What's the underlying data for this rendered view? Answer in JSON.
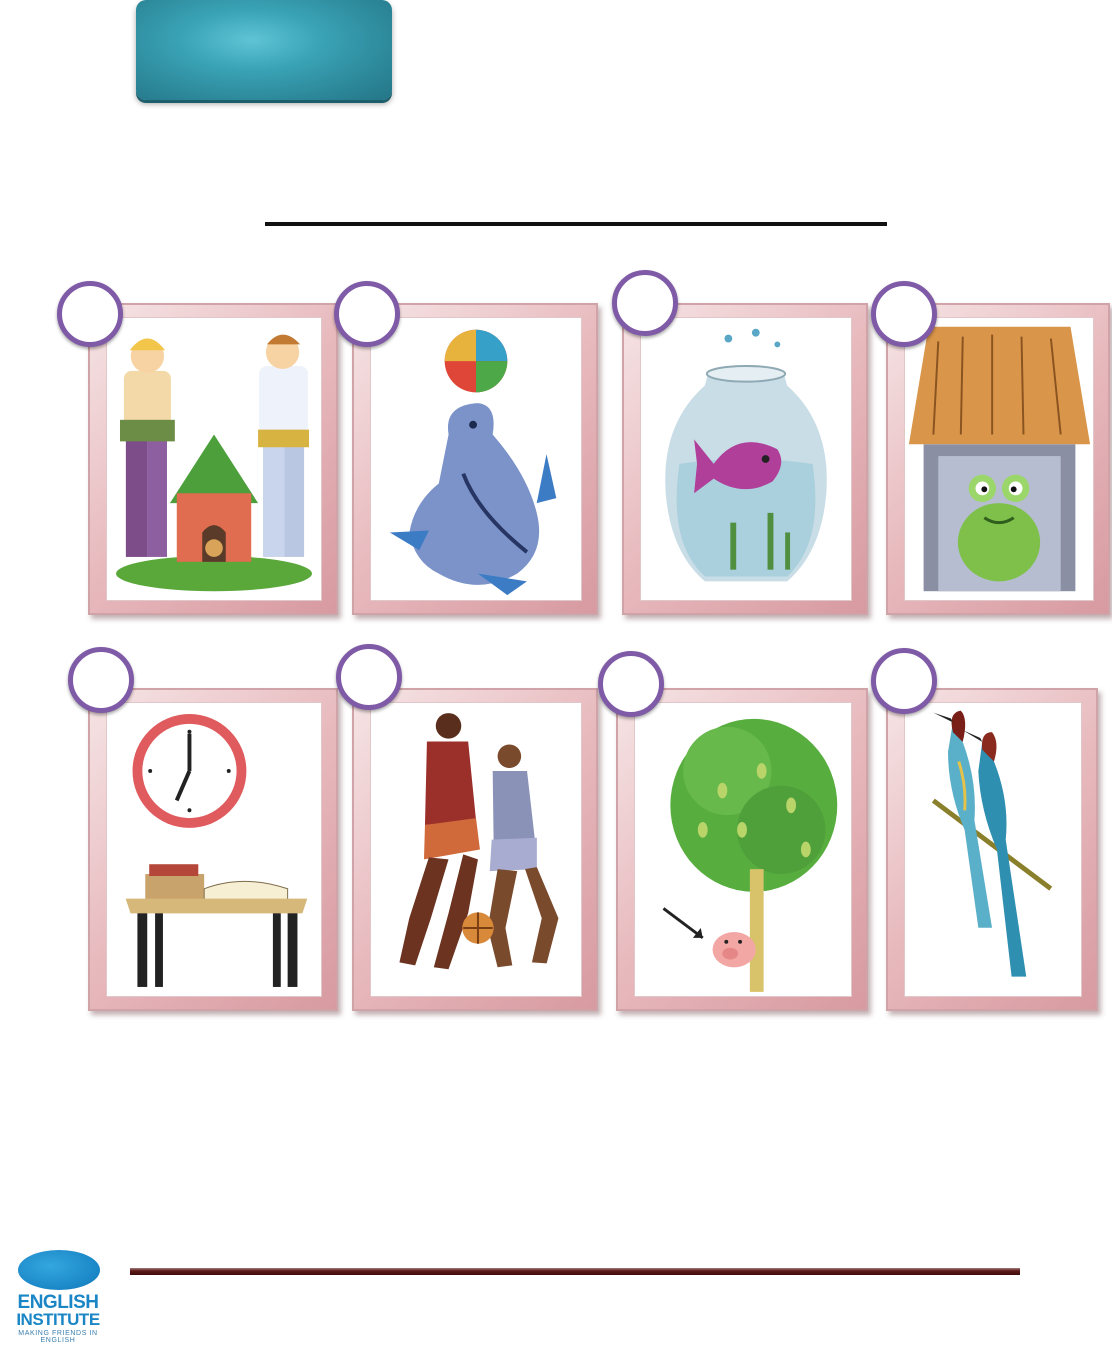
{
  "header": {
    "badge_label": ""
  },
  "title": {
    "text": ""
  },
  "cards": [
    {
      "icon": "doghouse-children-icon"
    },
    {
      "icon": "seal-ball-icon"
    },
    {
      "icon": "fishbowl-icon"
    },
    {
      "icon": "frog-house-icon"
    },
    {
      "icon": "clock-desk-icon"
    },
    {
      "icon": "basketball-players-icon"
    },
    {
      "icon": "pig-tree-icon"
    },
    {
      "icon": "birds-branch-icon"
    }
  ],
  "colors": {
    "badge": "#2b8697",
    "card_frame": "#d79aa0",
    "circle_border": "#7f5aa6",
    "footer_rule": "#5e1a1a",
    "logo_blue": "#1a86c6"
  },
  "footer": {
    "logo_line1": "ENGLISH",
    "logo_line2": "INSTITUTE",
    "logo_tagline": "MAKING FRIENDS IN ENGLISH"
  }
}
